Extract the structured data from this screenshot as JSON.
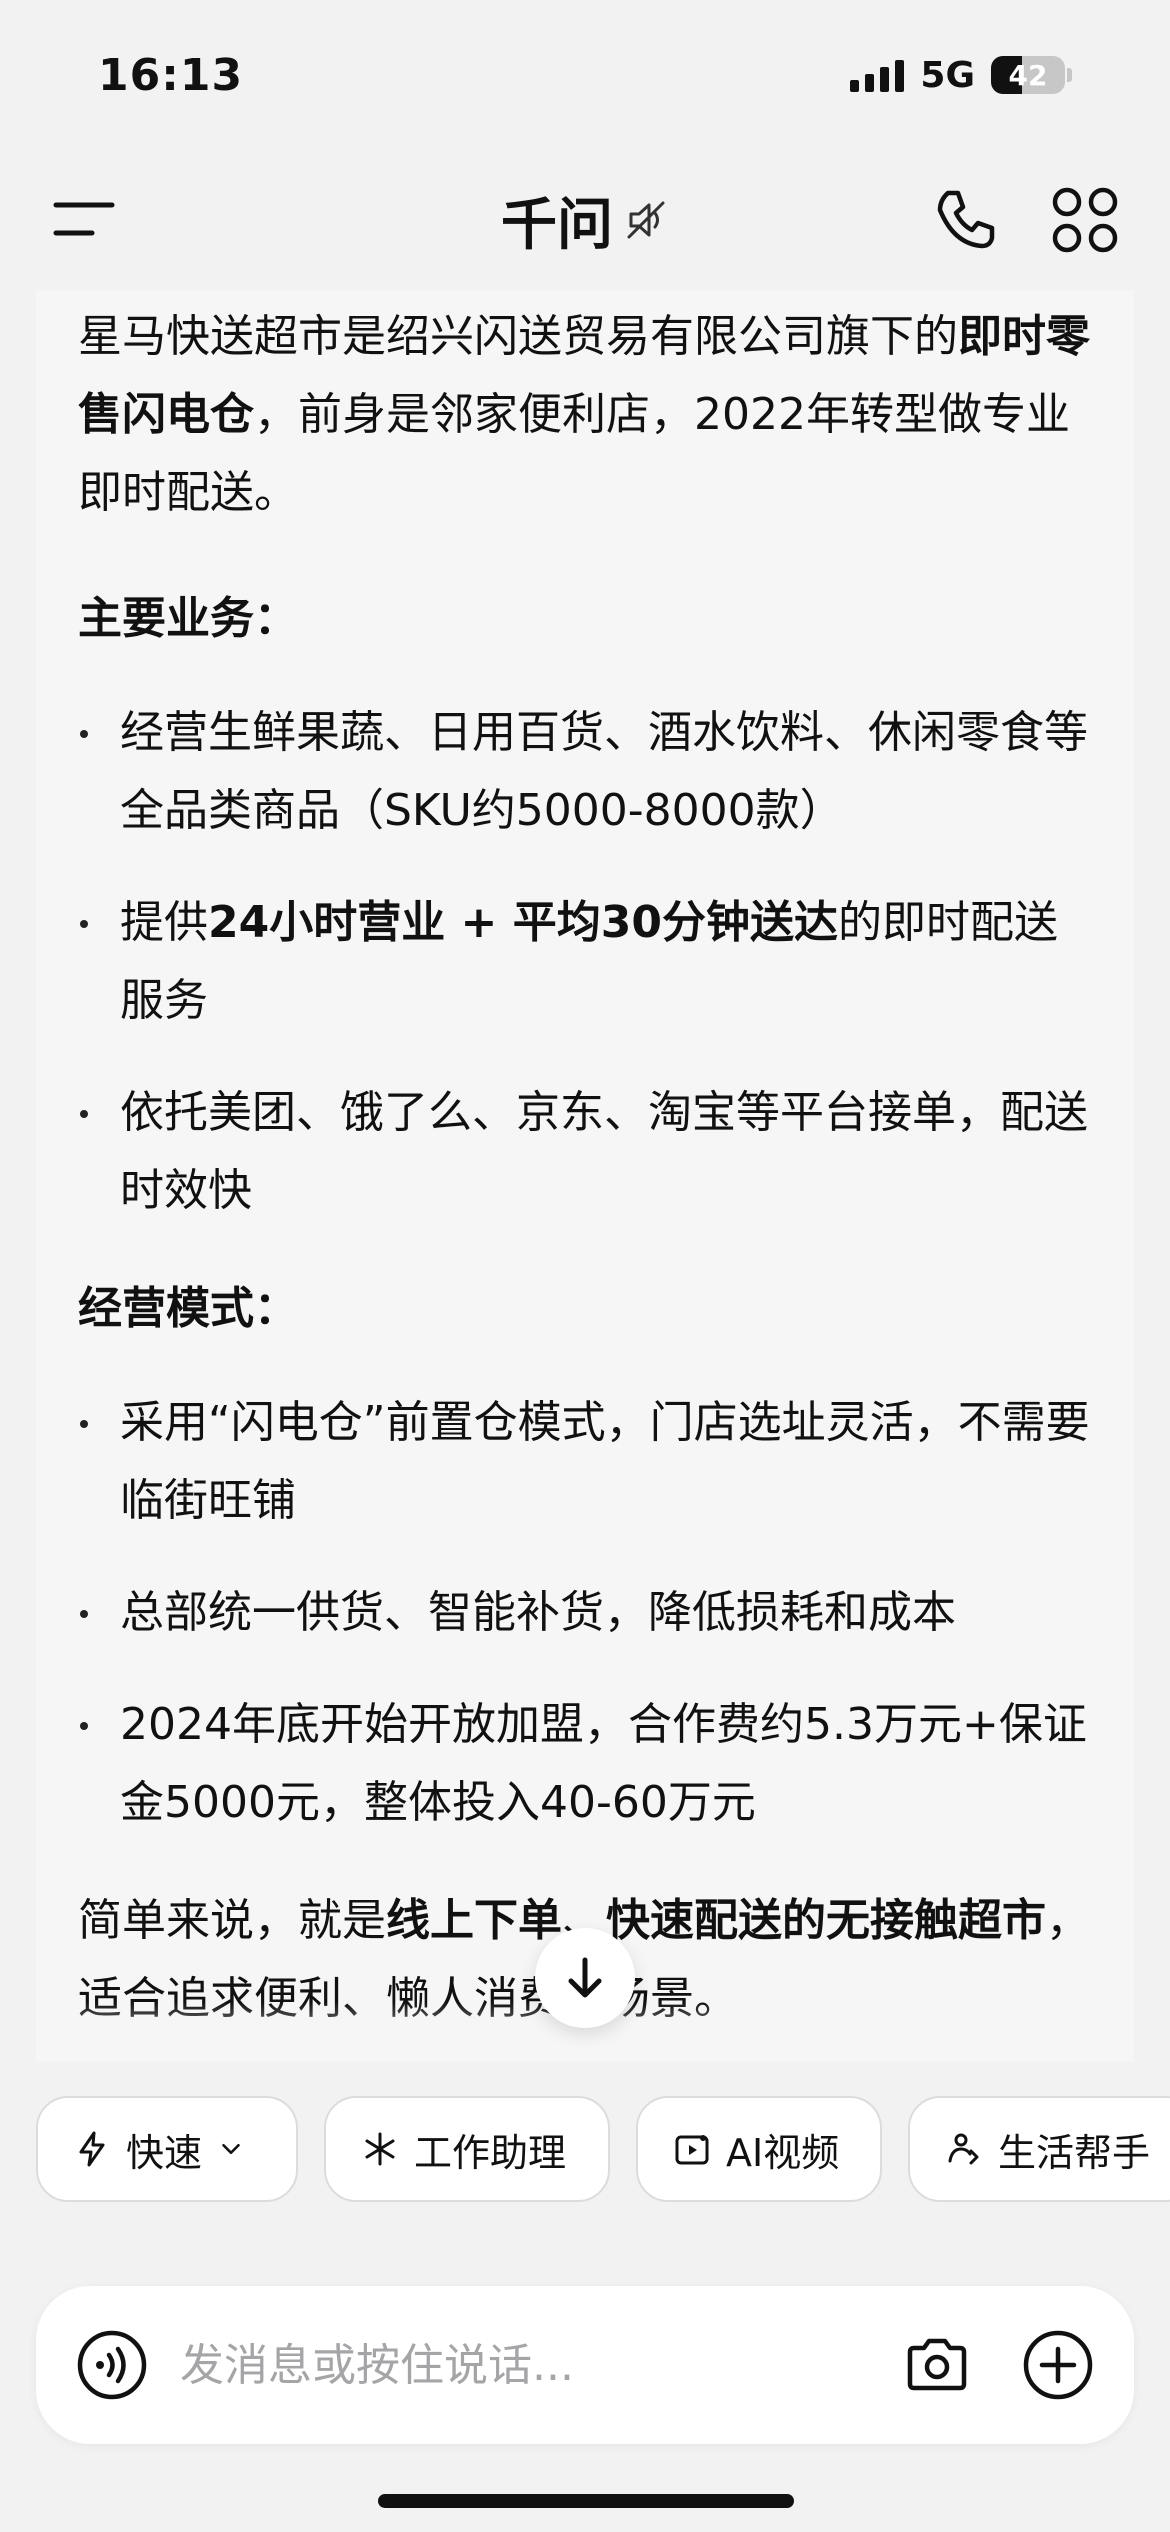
{
  "status_bar": {
    "time": "16:13",
    "network": "5G",
    "battery_percent": "42",
    "battery_level": 0.42
  },
  "nav": {
    "title": "千问"
  },
  "content": {
    "intro_1": "星马快送超市是绍兴闪送贸易有限公司旗下的",
    "intro_bold": "即时零售闪电仓",
    "intro_2": "，前身是邻家便利店，2022年转型做专业即时配送。",
    "section_1_title": "主要业务：",
    "section_1_items": [
      {
        "pre": "经营生鲜果蔬、日用百货、酒水饮料、休闲零食等全品类商品（SKU约5000-8000款）",
        "bold": "",
        "post": ""
      },
      {
        "pre": "提供",
        "bold": "24小时营业 + 平均30分钟送达",
        "post": "的即时配送服务"
      },
      {
        "pre": "依托美团、饿了么、京东、淘宝等平台接单，配送时效快",
        "bold": "",
        "post": ""
      }
    ],
    "section_2_title": "经营模式：",
    "section_2_items": [
      "采用“闪电仓”前置仓模式，门店选址灵活，不需要临街旺铺",
      "总部统一供货、智能补货，降低损耗和成本",
      "2024年底开始开放加盟，合作费约5.3万元+保证金5000元，整体投入40-60万元"
    ],
    "summary_pre": "简单来说，就是",
    "summary_bold_1": "线上下单",
    "summary_mid": "、",
    "summary_bold_2": "快速配送的无接触超市",
    "summary_post": "，适合追求便利、懒人消费的场景。"
  },
  "chips": [
    {
      "label": "快速",
      "icon": "lightning-icon",
      "dropdown": true
    },
    {
      "label": "工作助理",
      "icon": "sparkle-icon"
    },
    {
      "label": "AI视频",
      "icon": "video-icon"
    },
    {
      "label": "生活帮手",
      "icon": "life-helper-icon"
    }
  ],
  "input": {
    "placeholder": "发消息或按住说话..."
  },
  "colors": {
    "background": "#f2f2f3",
    "card": "#f6f6f7",
    "text": "#111111",
    "placeholder": "#a5a5a8"
  }
}
